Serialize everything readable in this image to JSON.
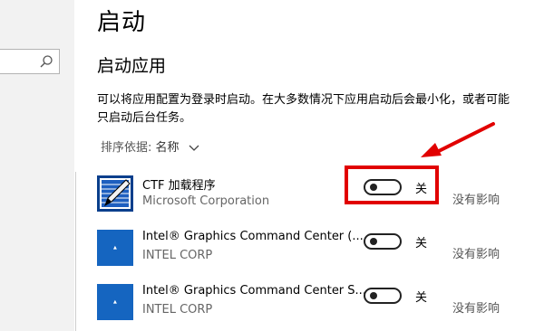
{
  "page": {
    "title": "启动",
    "section_title": "启动应用",
    "description": "可以将应用配置为登录时启动。在大多数情况下应用启动后会最小化，或者可能只启动后台任务。",
    "sort_prefix": "排序依据: ",
    "sort_value": "名称"
  },
  "apps": [
    {
      "name": "CTF 加载程序",
      "publisher": "Microsoft Corporation",
      "toggle_state": "关",
      "impact": "没有影响",
      "icon": "ctf-loader-icon"
    },
    {
      "name": "Intel® Graphics Command Center (...",
      "publisher": "INTEL CORP",
      "toggle_state": "关",
      "impact": "没有影响",
      "icon": "intel-graphics-icon"
    },
    {
      "name": "Intel® Graphics Command Center S...",
      "publisher": "INTEL CORP",
      "toggle_state": "关",
      "impact": "没有影响",
      "icon": "intel-graphics-icon"
    }
  ],
  "colors": {
    "highlight": "#e10000",
    "intel_blue": "#1565c0",
    "sidebar": "#f2f2f2"
  }
}
